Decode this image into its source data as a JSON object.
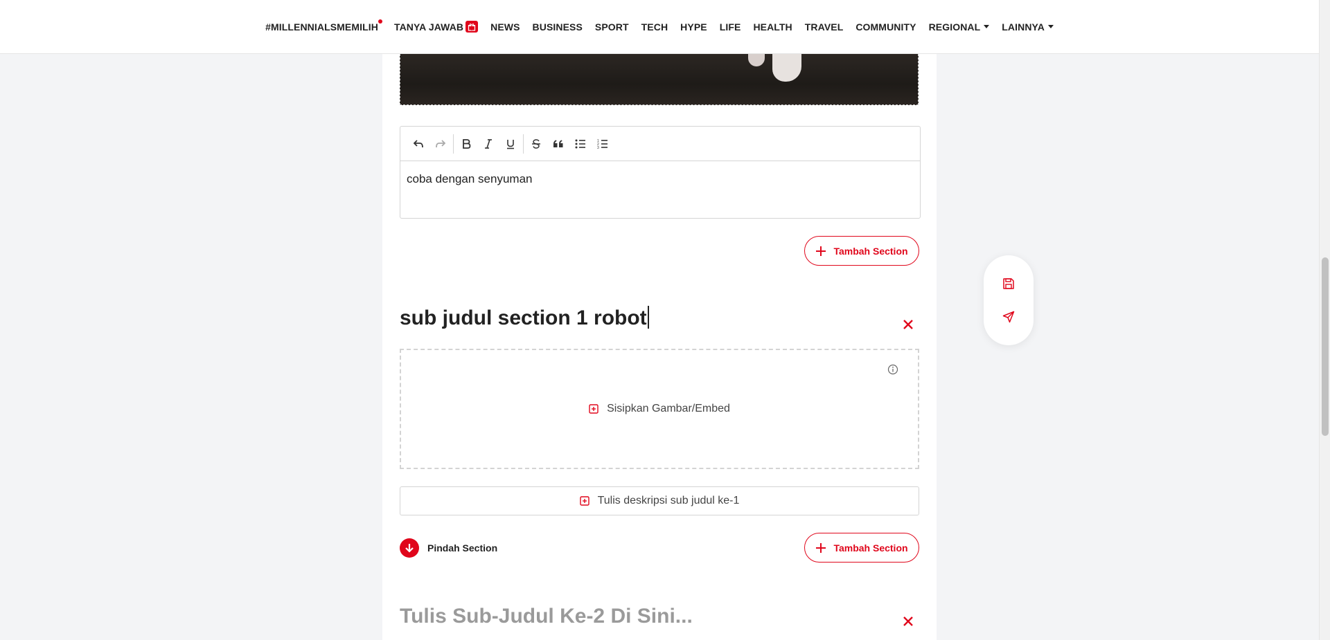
{
  "nav": {
    "items": [
      {
        "label": "#MILLENNIALSMEMILIH",
        "has_dot": true
      },
      {
        "label": "TANYA JAWAB",
        "has_badge": true
      },
      {
        "label": "NEWS"
      },
      {
        "label": "BUSINESS"
      },
      {
        "label": "SPORT"
      },
      {
        "label": "TECH"
      },
      {
        "label": "HYPE"
      },
      {
        "label": "LIFE"
      },
      {
        "label": "HEALTH"
      },
      {
        "label": "TRAVEL"
      },
      {
        "label": "COMMUNITY"
      },
      {
        "label": "REGIONAL",
        "has_caret": true
      },
      {
        "label": "LAINNYA",
        "has_caret": true
      }
    ]
  },
  "editor": {
    "toolbar": [
      "undo-icon",
      "redo-icon",
      "bold-icon",
      "italic-icon",
      "underline-icon",
      "strikethrough-icon",
      "quote-icon",
      "bullet-list-icon",
      "numbered-list-icon"
    ],
    "content": "coba dengan senyuman"
  },
  "actions": {
    "add_section_label": "Tambah Section",
    "move_section_label": "Pindah Section",
    "insert_media_label": "Sisipkan Gambar/Embed",
    "description_placeholder": "Tulis deskripsi sub judul ke-1"
  },
  "section1": {
    "subtitle": "sub judul section 1 robot"
  },
  "section2": {
    "subtitle_placeholder": "Tulis Sub-Judul Ke-2 Di Sini..."
  },
  "floating": {
    "buttons": [
      "save-icon",
      "send-icon"
    ]
  },
  "colors": {
    "accent": "#e0061b",
    "text": "#222222",
    "placeholder": "#9a9a9a",
    "border": "#d4d4d4"
  }
}
